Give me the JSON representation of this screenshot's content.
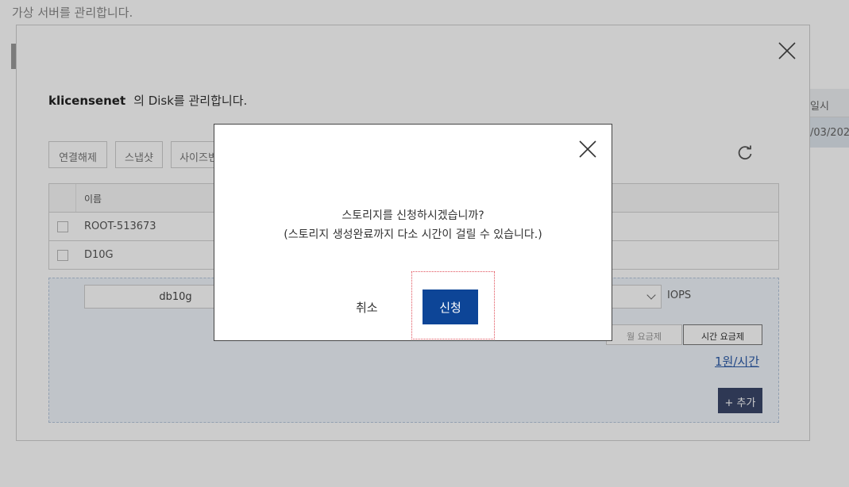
{
  "background": {
    "description": "가상 서버를 관리합니다.",
    "table_right_header": "일시",
    "table_right_cell": "/03/202"
  },
  "disk_modal": {
    "server_name": "klicensenet",
    "title_suffix": "의 Disk를 관리합니다.",
    "toolbar": {
      "detach_label": "연결해제",
      "snapshot_label": "스냅샷",
      "resize_label": "사이즈변"
    },
    "table": {
      "header_name": "이름",
      "rows": [
        {
          "name": "ROOT-513673"
        },
        {
          "name": "D10G"
        }
      ]
    },
    "add_panel": {
      "disk_name_value": "db10g",
      "iops_label": "IOPS",
      "monthly_label": "월 요금제",
      "hourly_label": "시간 요금제",
      "price": "1원/시간",
      "add_label": "+ 추가"
    }
  },
  "confirm_dialog": {
    "message_line1": "스토리지를 신청하시겠습니까?",
    "message_line2": "(스토리지 생성완료까지 다소 시간이 걸릴 수 있습니다.)",
    "cancel_label": "취소",
    "apply_label": "신청"
  },
  "colors": {
    "primary_button": "#0d4597",
    "add_button": "#3a4669",
    "link": "#2b5aa8"
  }
}
